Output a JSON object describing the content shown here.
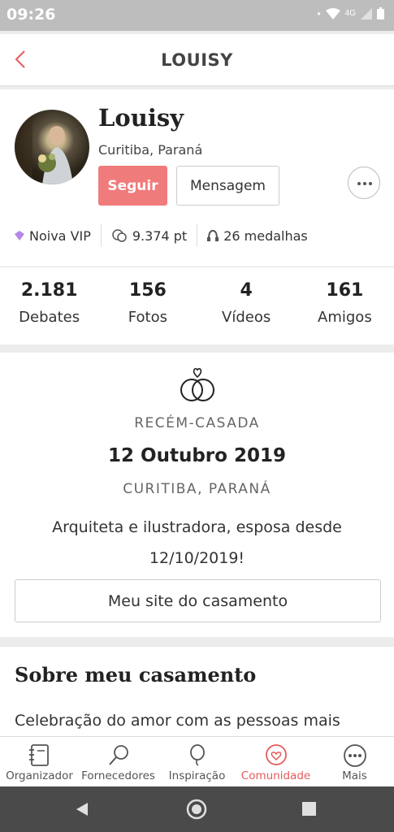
{
  "status_bar": {
    "time": "09:26",
    "network": "4G"
  },
  "header": {
    "title": "LOUISY"
  },
  "profile": {
    "name": "Louisy",
    "location": "Curitiba, Paraná",
    "follow_label": "Seguir",
    "message_label": "Mensagem",
    "badges": [
      {
        "icon": "diamond-icon",
        "label": "Noiva VIP"
      },
      {
        "icon": "chat-bubbles-icon",
        "label": "9.374 pt"
      },
      {
        "icon": "medal-icon",
        "label": "26 medalhas"
      }
    ]
  },
  "stats": [
    {
      "value": "2.181",
      "label": "Debates"
    },
    {
      "value": "156",
      "label": "Fotos"
    },
    {
      "value": "4",
      "label": "Vídeos"
    },
    {
      "value": "161",
      "label": "Amigos"
    }
  ],
  "wedding": {
    "status": "RECÉM-CASADA",
    "date": "12 Outubro 2019",
    "city": "CURITIBA, PARANÁ",
    "bio": "Arquiteta e ilustradora, esposa desde 12/10/2019!",
    "site_button": "Meu site do casamento"
  },
  "about": {
    "title": "Sobre meu casamento",
    "text": "Celebração do amor com as pessoas mais"
  },
  "bottom_nav": [
    {
      "label": "Organizador",
      "icon": "notebook-icon",
      "active": false
    },
    {
      "label": "Fornecedores",
      "icon": "search-icon",
      "active": false
    },
    {
      "label": "Inspiração",
      "icon": "balloon-icon",
      "active": false
    },
    {
      "label": "Comunidade",
      "icon": "chat-heart-icon",
      "active": true
    },
    {
      "label": "Mais",
      "icon": "more-icon",
      "active": false
    }
  ],
  "colors": {
    "accent": "#f07b7b",
    "active_nav": "#e85a5a",
    "vip": "#b388e8"
  }
}
